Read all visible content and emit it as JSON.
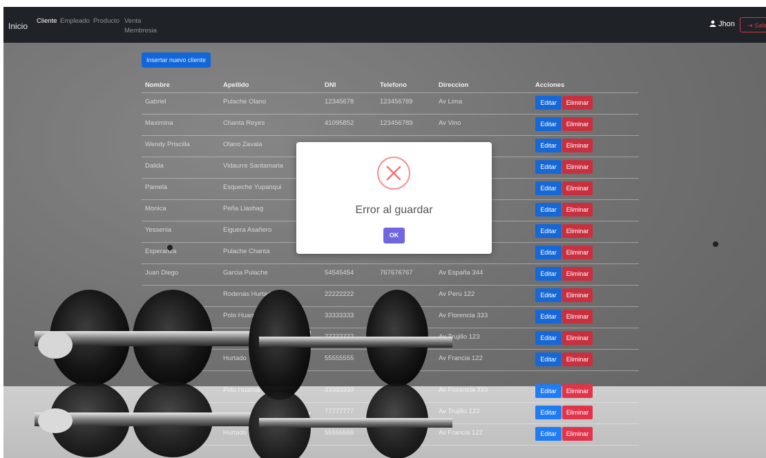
{
  "navbar": {
    "brand": "Inicio",
    "links": [
      "Cliente",
      "Empleado",
      "Producto",
      "Venta",
      "Membresia"
    ],
    "user": "Jhon",
    "logout": "Salir"
  },
  "insert_button": "Insertar nuevo cliente",
  "table": {
    "headers": [
      "Nombre",
      "Apellido",
      "DNI",
      "Telefono",
      "Direccion",
      "Acciones"
    ],
    "rows": [
      [
        "Gabriel",
        "Pulache Olano",
        "12345678",
        "123456789",
        "Av Lima"
      ],
      [
        "Maximina",
        "Chanta Reyes",
        "41095852",
        "123456789",
        "Av Vino"
      ],
      [
        "Wendy Priscilla",
        "Olano Zavala",
        "",
        "",
        ""
      ],
      [
        "Dalida",
        "Vidaurre Santamaria",
        "",
        "",
        ""
      ],
      [
        "Pamela",
        "Esqueche Yupanqui",
        "",
        "",
        ""
      ],
      [
        "Monica",
        "Peña Llashag",
        "",
        "",
        ""
      ],
      [
        "Yessenia",
        "Eiguera Asañero",
        "",
        "",
        ""
      ],
      [
        "Esperanza",
        "Pulache Chanta",
        "",
        "",
        ""
      ],
      [
        "Juan Diego",
        "Garcia Pulache",
        "54545454",
        "767676767",
        "Av España 344"
      ],
      [
        "",
        "Rodenas Hurtado",
        "22222222",
        "",
        "Av Peru 122"
      ],
      [
        "",
        "Polo Huamán",
        "33333333",
        "",
        "Av Florencia 333"
      ],
      [
        "",
        "",
        "77777777",
        "",
        "Av Trujillo 123"
      ],
      [
        "",
        "Hurtado",
        "55555555",
        "",
        "Av Francia 122"
      ]
    ],
    "lower_rows": [
      [
        "",
        "Polo Huamán",
        "33333333",
        "",
        "Av Florencia 333"
      ],
      [
        "",
        "",
        "77777777",
        "",
        "Av Trujillo 123"
      ],
      [
        "",
        "Hurtado",
        "55555555",
        "",
        "Av Francia 122"
      ]
    ],
    "edit_label": "Editar",
    "delete_label": "Eliminar"
  },
  "modal": {
    "title": "Error al guardar",
    "ok_label": "OK",
    "icon": "error-x-icon"
  },
  "colors": {
    "navbar": "#1f2226",
    "edit": "#1668d6",
    "delete": "#c9303f",
    "ok": "#7066e0",
    "error": "#f27474"
  }
}
